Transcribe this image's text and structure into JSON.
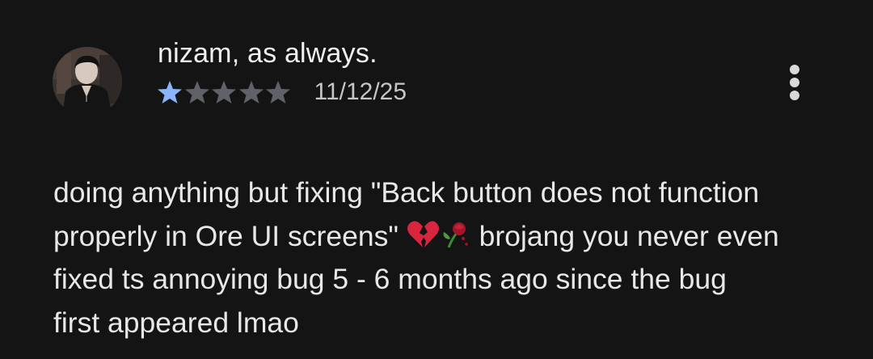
{
  "review": {
    "reviewer_name": "nizam, as always.",
    "avatar_icon": "user-avatar-photo",
    "rating": 1,
    "max_rating": 5,
    "colors": {
      "star_filled": "#8ab4f8",
      "star_empty": "#5f6368",
      "background": "#141414",
      "text": "#e8e8e8"
    },
    "date": "11/12/25",
    "more_icon": "more-vert-icon",
    "text_lines": [
      "doing anything but fixing \"Back button does not function",
      "properly in Ore UI screens\"",
      " brojang you never even",
      "fixed ts annoying bug 5 - 6 months ago since the bug",
      "first appeared lmao"
    ],
    "emojis": [
      "broken-heart-icon",
      "wilted-rose-icon"
    ]
  }
}
